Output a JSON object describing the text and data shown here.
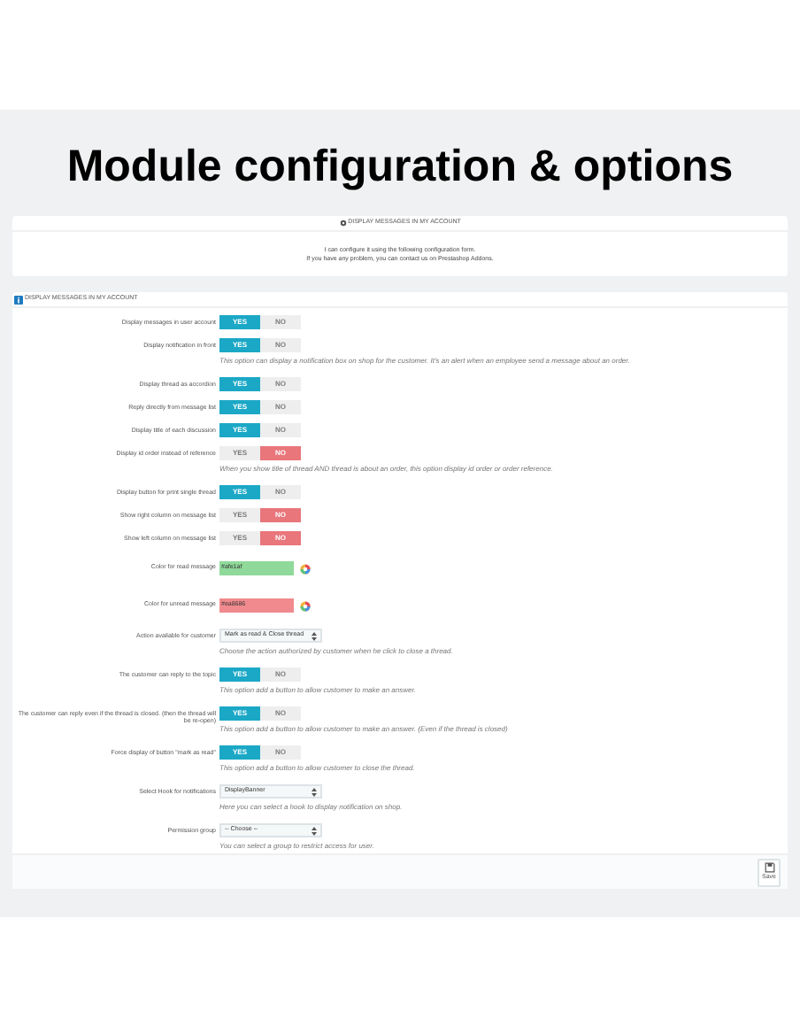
{
  "heading": "Module configuration & options",
  "info_panel": {
    "title": "DISPLAY MESSAGES IN MY ACCOUNT",
    "lines": [
      "I can configure it using the following configuration form.",
      "If you have any problem, you can contact us on Prestashop Addons."
    ]
  },
  "form_panel": {
    "title": "DISPLAY MESSAGES IN MY ACCOUNT",
    "rows": [
      {
        "kind": "toggle",
        "label": "Display messages in user account",
        "on": true,
        "yes": "YES",
        "no": "NO"
      },
      {
        "kind": "toggle",
        "label": "Display notification in front",
        "on": true,
        "yes": "YES",
        "no": "NO",
        "hint": "This option can display a notification box on shop for the customer. It's an alert when an employee send a message about an order."
      },
      {
        "kind": "toggle",
        "label": "Display thread as accordion",
        "on": true,
        "yes": "YES",
        "no": "NO"
      },
      {
        "kind": "toggle",
        "label": "Reply directly from message list",
        "on": true,
        "yes": "YES",
        "no": "NO"
      },
      {
        "kind": "toggle",
        "label": "Display title of each discussion",
        "on": true,
        "yes": "YES",
        "no": "NO"
      },
      {
        "kind": "toggle",
        "label": "Display id order instead of reference",
        "on": false,
        "yes": "YES",
        "no": "NO",
        "hint": "When you show title of thread AND thread is about an order, this option display id order or order reference."
      },
      {
        "kind": "toggle",
        "label": "Display button for print single thread",
        "on": true,
        "yes": "YES",
        "no": "NO"
      },
      {
        "kind": "toggle",
        "label": "Show right column on message list",
        "on": false,
        "yes": "YES",
        "no": "NO"
      },
      {
        "kind": "toggle",
        "label": "Show left column on message list",
        "on": false,
        "yes": "YES",
        "no": "NO"
      },
      {
        "kind": "color",
        "label": "Color for read message",
        "value": "#afe1af",
        "color": "#8fd99a"
      },
      {
        "kind": "color",
        "label": "Color for unread message",
        "value": "#ea8686",
        "color": "#f08a8e"
      },
      {
        "kind": "select",
        "label": "Action available for customer",
        "value": "Mark as read & Close thread",
        "hint": "Choose the action authorized by customer when he click to close a thread."
      },
      {
        "kind": "toggle",
        "label": "The customer can reply to the topic",
        "on": true,
        "yes": "YES",
        "no": "NO",
        "hint": "This option add a button to allow customer to make an answer."
      },
      {
        "kind": "toggle",
        "label": "The customer can reply even if the thread is closed. (then the thread will be re-open)",
        "on": true,
        "yes": "YES",
        "no": "NO",
        "hint": "This option add a button to allow customer to make an answer. (Even if the thread is closed)"
      },
      {
        "kind": "toggle",
        "label": "Force display of button \"mark as read\"",
        "on": true,
        "yes": "YES",
        "no": "NO",
        "hint": "This option add a button to allow customer to close the thread."
      },
      {
        "kind": "select",
        "label": "Select Hook for notifications",
        "value": "DisplayBanner",
        "hint": "Here you can select a hook to display notification on shop."
      },
      {
        "kind": "select",
        "label": "Permission group",
        "value": "-- Choose --",
        "hint": "You can select a group to restrict access for user."
      }
    ],
    "save": "Save"
  }
}
